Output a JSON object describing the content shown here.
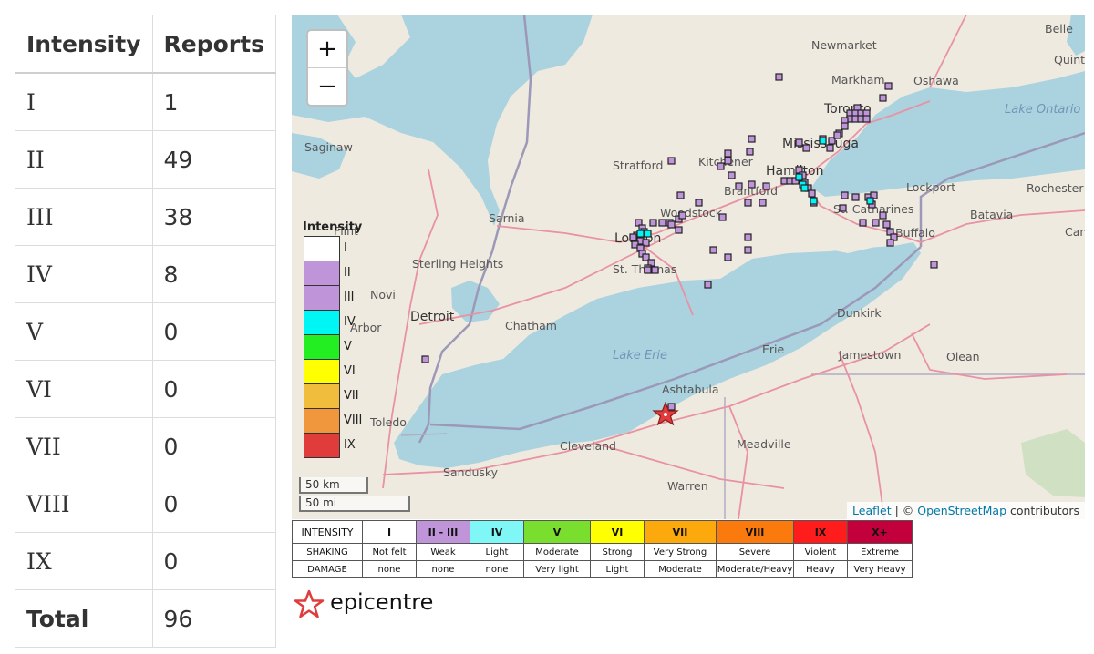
{
  "table": {
    "headers": [
      "Intensity",
      "Reports"
    ],
    "rows": [
      {
        "intensity": "I",
        "reports": "1"
      },
      {
        "intensity": "II",
        "reports": "49"
      },
      {
        "intensity": "III",
        "reports": "38"
      },
      {
        "intensity": "IV",
        "reports": "8"
      },
      {
        "intensity": "V",
        "reports": "0"
      },
      {
        "intensity": "VI",
        "reports": "0"
      },
      {
        "intensity": "VII",
        "reports": "0"
      },
      {
        "intensity": "VIII",
        "reports": "0"
      },
      {
        "intensity": "IX",
        "reports": "0"
      }
    ],
    "total_label": "Total",
    "total_value": "96"
  },
  "map": {
    "zoom_in": "+",
    "zoom_out": "−",
    "legend": {
      "title": "Intensity",
      "items": [
        {
          "label": "I",
          "color": "#ffffff"
        },
        {
          "label": "II",
          "color": "#bf94d8"
        },
        {
          "label": "III",
          "color": "#bf94d8"
        },
        {
          "label": "IV",
          "color": "#00f5f5"
        },
        {
          "label": "V",
          "color": "#22ee22"
        },
        {
          "label": "VI",
          "color": "#ffff00"
        },
        {
          "label": "VII",
          "color": "#f0be3c"
        },
        {
          "label": "VIII",
          "color": "#f0963c"
        },
        {
          "label": "IX",
          "color": "#e03c3c"
        }
      ]
    },
    "scale_km": "50 km",
    "scale_mi": "50 mi",
    "attribution": {
      "leaflet": "Leaflet",
      "separator": " | © ",
      "osm": "OpenStreetMap",
      "suffix": " contributors"
    },
    "places": {
      "belle": "Belle",
      "quinte_west": "Quinte West",
      "newmarket": "Newmarket",
      "markham": "Markham",
      "oshawa": "Oshawa",
      "toronto": "Toronto",
      "lake_ontario": "Lake Ontario",
      "saginaw": "Saginaw",
      "mississauga": "Mississauga",
      "stratford": "Stratford",
      "kitchener": "Kitchener",
      "hamilton": "Hamilton",
      "brantford": "Brantford",
      "lockport": "Lockport",
      "rochester": "Rochester",
      "sarnia": "Sarnia",
      "woodstock": "Woodstock",
      "st_catharines": "St. Catharines",
      "batavia": "Batavia",
      "flint": "Flint",
      "london": "London",
      "buffalo": "Buffalo",
      "canandaigua": "Cana",
      "sterling_heights": "Sterling Heights",
      "st_thomas": "St. Thomas",
      "novi": "Novi",
      "detroit": "Detroit",
      "chatham": "Chatham",
      "ann_arbor": "Arbor",
      "dunkirk": "Dunkirk",
      "lake_erie": "Lake Erie",
      "erie": "Erie",
      "jamestown": "Jamestown",
      "olean": "Olean",
      "toledo": "Toledo",
      "ashtabula": "Ashtabula",
      "cleveland": "Cleveland",
      "meadville": "Meadville",
      "sandusky": "Sandusky",
      "warren": "Warren"
    }
  },
  "scale_table": {
    "header": "INTENSITY",
    "shaking_label": "SHAKING",
    "damage_label": "DAMAGE",
    "columns": [
      {
        "intensity": "I",
        "color": "#ffffff",
        "shaking": "Not felt",
        "damage": "none"
      },
      {
        "intensity": "II - III",
        "color": "#bf94d8",
        "shaking": "Weak",
        "damage": "none"
      },
      {
        "intensity": "IV",
        "color": "#7ff7f7",
        "shaking": "Light",
        "damage": "none"
      },
      {
        "intensity": "V",
        "color": "#79de2e",
        "shaking": "Moderate",
        "damage": "Very light"
      },
      {
        "intensity": "VI",
        "color": "#ffff00",
        "shaking": "Strong",
        "damage": "Light"
      },
      {
        "intensity": "VII",
        "color": "#fba90d",
        "shaking": "Very Strong",
        "damage": "Moderate"
      },
      {
        "intensity": "VIII",
        "color": "#fb7a0d",
        "shaking": "Severe",
        "damage": "Moderate/Heavy"
      },
      {
        "intensity": "IX",
        "color": "#ff1c1c",
        "shaking": "Violent",
        "damage": "Heavy"
      },
      {
        "intensity": "X+",
        "color": "#c2003c",
        "shaking": "Extreme",
        "damage": "Very Heavy"
      }
    ]
  },
  "epicentre_label": "epicentre",
  "colors": {
    "water": "#aad3df",
    "land": "#efeae0",
    "border": "#9c98b8",
    "highway": "#e892a2",
    "report_fill": "#bf94d8",
    "iv_fill": "#00f5f5",
    "epicentre": "#e03c3c"
  }
}
